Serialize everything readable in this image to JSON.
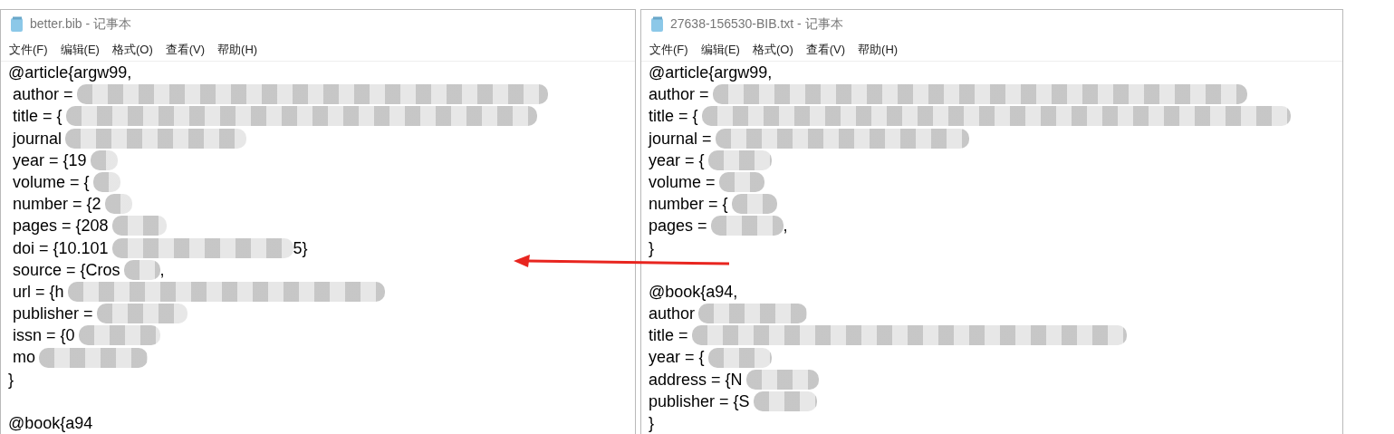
{
  "windows": [
    {
      "title": "better.bib - 记事本",
      "menu": [
        "文件(F)",
        "编辑(E)",
        "格式(O)",
        "查看(V)",
        "帮助(H)"
      ],
      "lines": [
        {
          "text": "@article{argw99,",
          "redacted": false
        },
        {
          "text": " author =",
          "redacted": true
        },
        {
          "text": " title = {",
          "redacted": true
        },
        {
          "text": " journal",
          "redacted": true
        },
        {
          "text": " year = {19",
          "redacted": true
        },
        {
          "text": " volume = {",
          "redacted": true
        },
        {
          "text": " number = {2",
          "redacted": true
        },
        {
          "text": " pages = {208",
          "redacted": true
        },
        {
          "text": " doi = {10.101",
          "redacted": true,
          "tail": "5}"
        },
        {
          "text": " source = {Cros",
          "redacted": true,
          "tail": ","
        },
        {
          "text": " url = {h",
          "redacted": true
        },
        {
          "text": " publisher =",
          "redacted": true
        },
        {
          "text": " issn = {0",
          "redacted": true
        },
        {
          "text": " mo",
          "redacted": true
        },
        {
          "text": "}",
          "redacted": false
        },
        {
          "redacted": false
        },
        {
          "text": "@book{a94",
          "redacted": false
        }
      ]
    },
    {
      "title": "27638-156530-BIB.txt - 记事本",
      "menu": [
        "文件(F)",
        "编辑(E)",
        "格式(O)",
        "查看(V)",
        "帮助(H)"
      ],
      "lines": [
        {
          "text": "@article{argw99,",
          "redacted": false
        },
        {
          "text": "author =",
          "redacted": true
        },
        {
          "text": "title = {",
          "redacted": true
        },
        {
          "text": "journal =",
          "redacted": true
        },
        {
          "text": "year = {",
          "redacted": true
        },
        {
          "text": "volume =",
          "redacted": true
        },
        {
          "text": "number = {",
          "redacted": true
        },
        {
          "text": "pages =",
          "redacted": true,
          "tail": ","
        },
        {
          "text": "}",
          "redacted": false
        },
        {
          "redacted": false
        },
        {
          "text": "@book{a94,",
          "redacted": false
        },
        {
          "text": "author",
          "redacted": true
        },
        {
          "text": "title =",
          "redacted": true
        },
        {
          "text": "year = {",
          "redacted": true
        },
        {
          "text": "address = {N",
          "redacted": true
        },
        {
          "text": "publisher = {S",
          "redacted": true
        },
        {
          "text": "}",
          "redacted": false
        }
      ]
    }
  ],
  "arrow": {
    "color": "#e8251f"
  }
}
